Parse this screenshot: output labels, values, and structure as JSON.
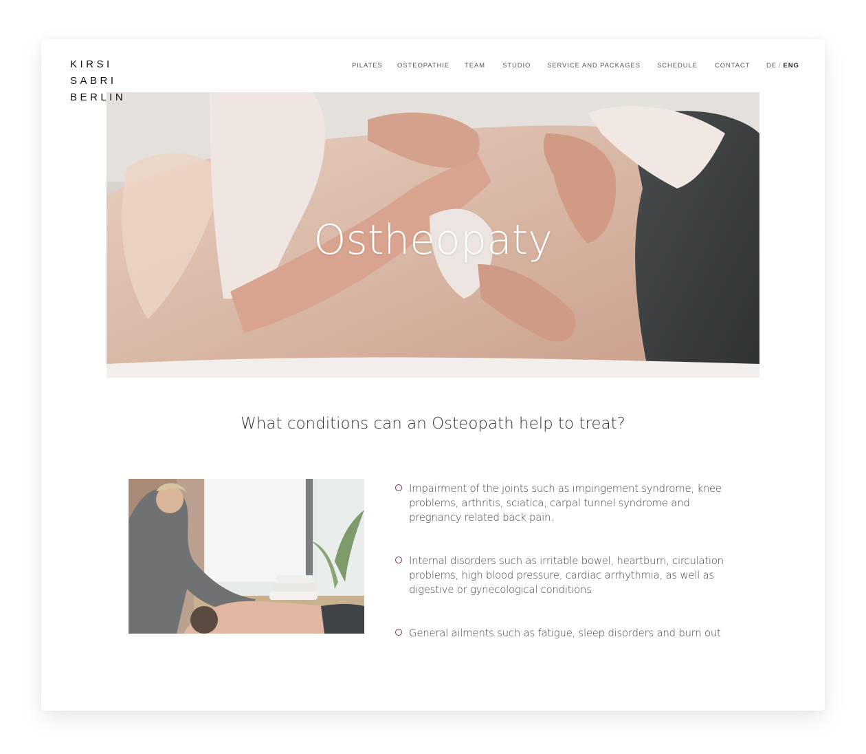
{
  "logo": {
    "lines": [
      "KIRSI",
      "SABRI",
      "BERLIN"
    ]
  },
  "nav": {
    "items": [
      "PILATES",
      "OSTEOPATHIE",
      "TEAM",
      "STUDIO",
      "SERVICE AND PACKAGES",
      "SCHEDULE",
      "CONTACT"
    ],
    "lang_de": "DE",
    "lang_sep": "/",
    "lang_eng": "ENG"
  },
  "hero": {
    "title": "Ostheopaty"
  },
  "section": {
    "heading": "What conditions can an Osteopath help to treat?"
  },
  "conditions": [
    "Impairment of the joints such as impingement syndrome, knee problems, arthritis, sciatica, carpal tunnel syndrome and pregnancy related back pain.",
    "Internal disorders such as irritable bowel, heartburn, circulation problems, high blood pressure, cardiac arrhythmia, as well as digestive or gynecological conditions",
    "General ailments such as fatigue, sleep disorders and burn out"
  ],
  "colors": {
    "bullet": "#7a2b3f",
    "text": "#444444",
    "nav": "#555555"
  },
  "icons": {
    "bullet": "circle-outline-icon"
  }
}
